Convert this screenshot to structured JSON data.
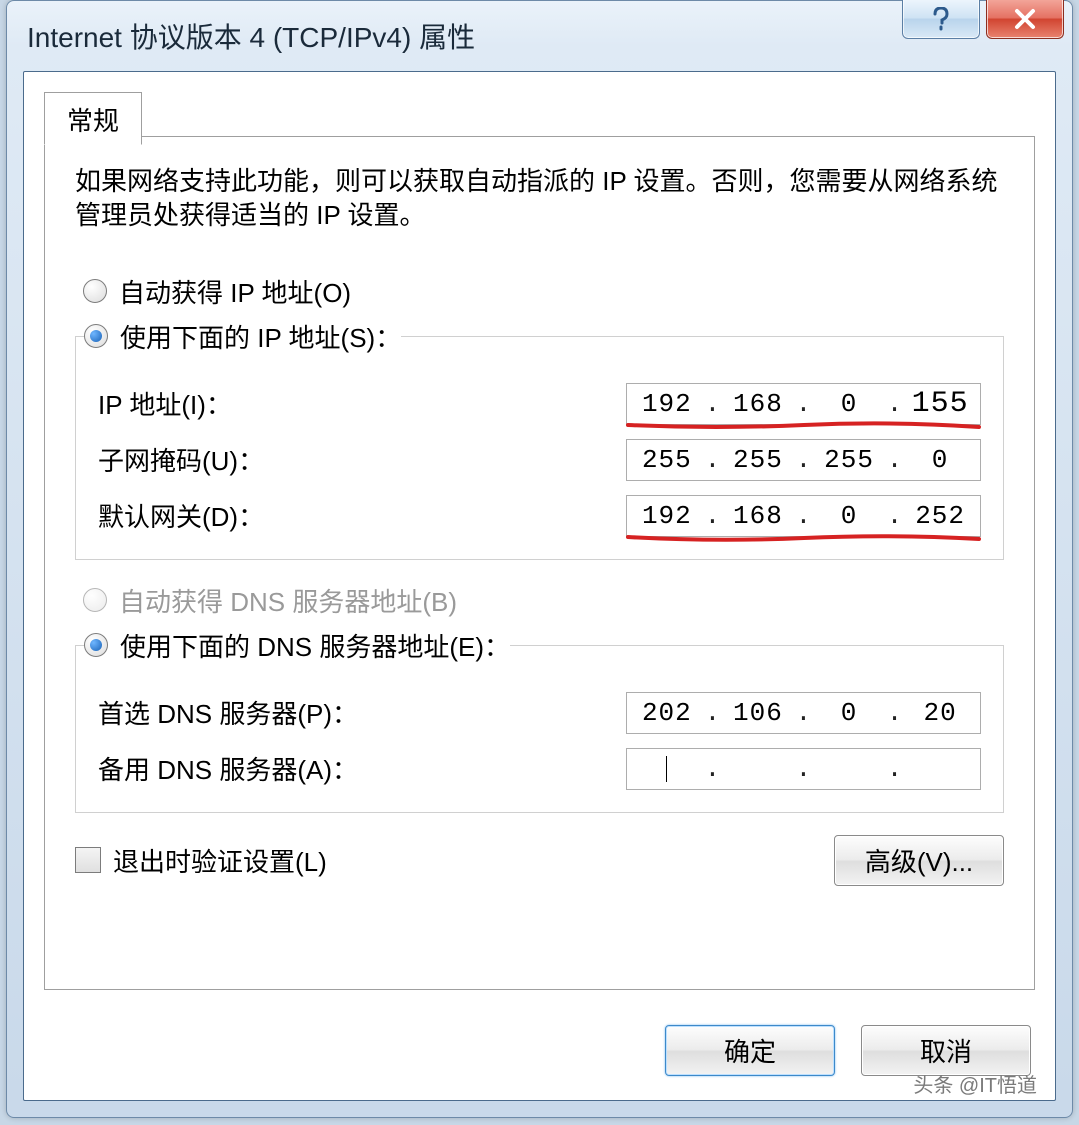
{
  "title": "Internet 协议版本 4 (TCP/IPv4) 属性",
  "tab": {
    "general": "常规"
  },
  "description": "如果网络支持此功能，则可以获取自动指派的 IP 设置。否则，您需要从网络系统管理员处获得适当的 IP 设置。",
  "ip_group": {
    "auto_label": "自动获得 IP 地址(O)",
    "manual_label": "使用下面的 IP 地址(S)：",
    "fields": {
      "ip_label": "IP 地址(I)：",
      "ip_value": {
        "o1": "192",
        "o2": "168",
        "o3": "0",
        "o4": "155"
      },
      "mask_label": "子网掩码(U)：",
      "mask_value": {
        "o1": "255",
        "o2": "255",
        "o3": "255",
        "o4": "0"
      },
      "gw_label": "默认网关(D)：",
      "gw_value": {
        "o1": "192",
        "o2": "168",
        "o3": "0",
        "o4": "252"
      }
    }
  },
  "dns_group": {
    "auto_label": "自动获得 DNS 服务器地址(B)",
    "manual_label": "使用下面的 DNS 服务器地址(E)：",
    "fields": {
      "pref_label": "首选 DNS 服务器(P)：",
      "pref_value": {
        "o1": "202",
        "o2": "106",
        "o3": "0",
        "o4": "20"
      },
      "alt_label": "备用 DNS 服务器(A)：",
      "alt_value": {
        "o1": "",
        "o2": "",
        "o3": "",
        "o4": ""
      }
    }
  },
  "validate_label": "退出时验证设置(L)",
  "advanced_label": "高级(V)...",
  "ok_label": "确定",
  "cancel_label": "取消",
  "watermark": "头条 @IT悟道"
}
